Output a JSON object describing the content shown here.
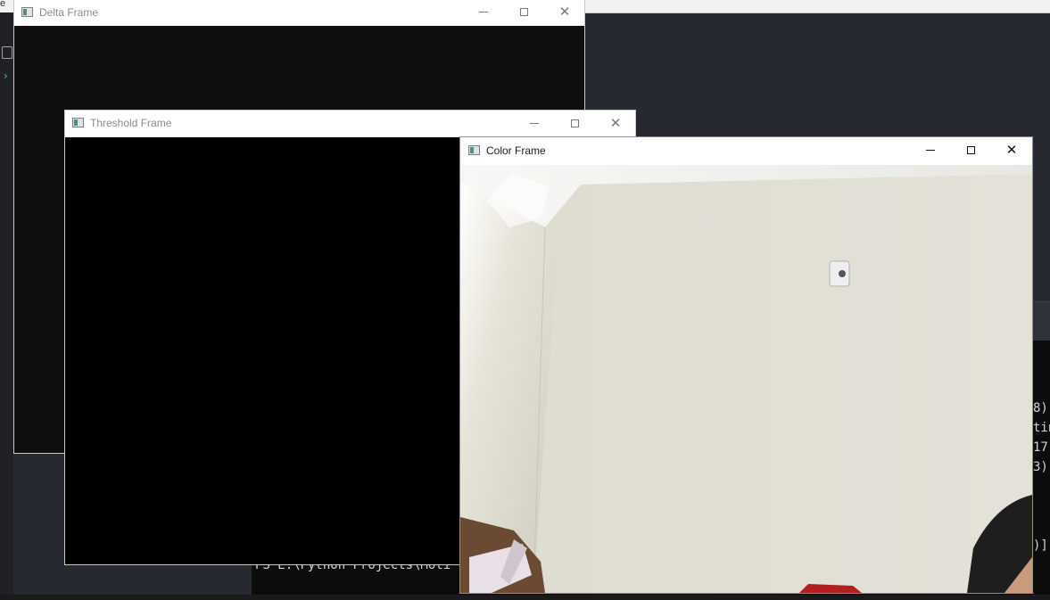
{
  "desktop": {
    "top_left_fragment": "e",
    "terminal": {
      "prompt_line": "PS E:\\Python Projects\\Moti",
      "right_fragments": [
        "8)",
        "tin",
        "17",
        "3)",
        ")]"
      ]
    }
  },
  "windows": {
    "delta": {
      "title": "Delta Frame"
    },
    "threshold": {
      "title": "Threshold Frame"
    },
    "color": {
      "title": "Color Frame"
    }
  },
  "window_controls": {
    "minimize": "minimize-icon",
    "maximize": "maximize-icon",
    "close": "close-icon"
  },
  "colors": {
    "active_border": "#e8733a",
    "wall": "#e6e4db",
    "threshold_bg": "#000000",
    "delta_bg": "#0e0e0e"
  }
}
